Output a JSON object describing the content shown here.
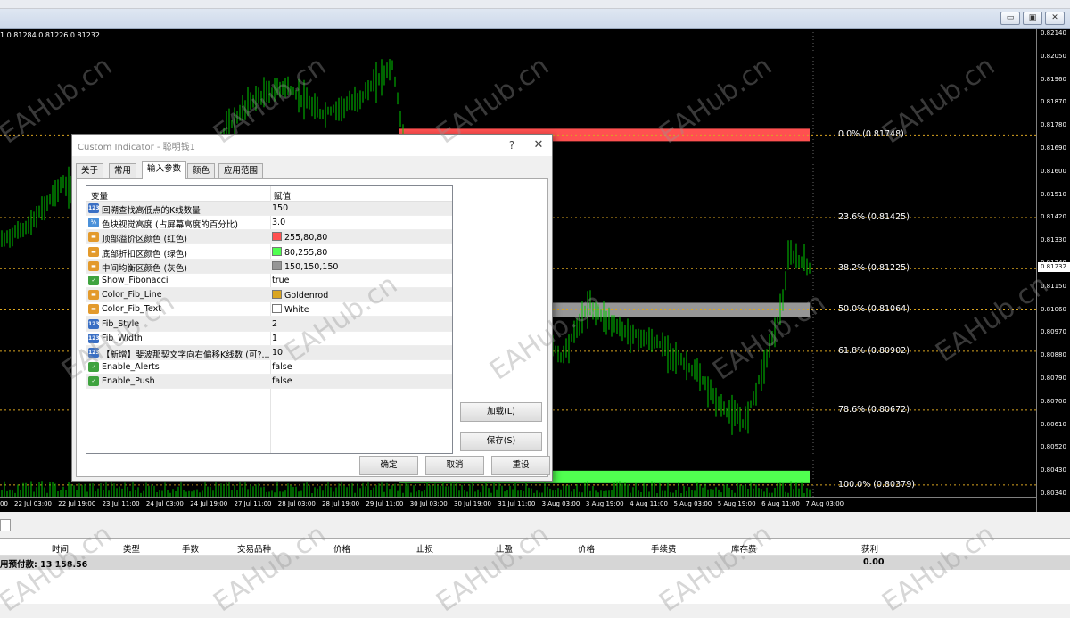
{
  "window": {
    "min_btn": "▭",
    "restore_btn": "▣",
    "close_btn": "✕"
  },
  "chart": {
    "ohlc_header": "1 0.81284 0.81226 0.81232",
    "current_price": "0.81232",
    "price_labels": [
      "0.82140",
      "0.82050",
      "0.81960",
      "0.81870",
      "0.81780",
      "0.81690",
      "0.81600",
      "0.81510",
      "0.81420",
      "0.81330",
      "0.81240",
      "0.81150",
      "0.81060",
      "0.80970",
      "0.80880",
      "0.80790",
      "0.80700",
      "0.80610",
      "0.80520",
      "0.80430",
      "0.80340"
    ],
    "time_labels": [
      "00",
      "22 Jul 03:00",
      "22 Jul 19:00",
      "23 Jul 11:00",
      "24 Jul 03:00",
      "24 Jul 19:00",
      "27 Jul 11:00",
      "28 Jul 03:00",
      "28 Jul 19:00",
      "29 Jul 11:00",
      "30 Jul 03:00",
      "30 Jul 19:00",
      "31 Jul 11:00",
      "3 Aug 03:00",
      "3 Aug 19:00",
      "4 Aug 11:00",
      "5 Aug 03:00",
      "5 Aug 19:00",
      "6 Aug 11:00",
      "7 Aug 03:00"
    ],
    "fib_levels": [
      {
        "label": "0.0% (0.81748)",
        "price": 0.81748
      },
      {
        "label": "23.6% (0.81425)",
        "price": 0.81425
      },
      {
        "label": "38.2% (0.81225)",
        "price": 0.81225
      },
      {
        "label": "50.0% (0.81064)",
        "price": 0.81064
      },
      {
        "label": "61.8% (0.80902)",
        "price": 0.80902
      },
      {
        "label": "78.6% (0.80672)",
        "price": 0.80672
      },
      {
        "label": "100.0% (0.80379)",
        "price": 0.80379
      }
    ],
    "zone_colors": {
      "premium": "#FF5050",
      "discount": "#50FF50",
      "equilibrium": "#969696"
    },
    "candle_color": "#00c800"
  },
  "terminal": {
    "columns": [
      "时间",
      "类型",
      "手数",
      "交易品种",
      "价格",
      "止损",
      "止盈",
      "价格",
      "手续费",
      "库存费",
      "获利"
    ],
    "balance_label": "用预付款: 13 158.56",
    "profit_total": "0.00"
  },
  "dialog": {
    "title": "Custom Indicator - 聪明钱1",
    "help": "?",
    "close": "✕",
    "tabs": [
      "关于",
      "常用",
      "输入参数",
      "颜色",
      "应用范围"
    ],
    "active_tab": "输入参数",
    "col_variable": "变量",
    "col_value": "赋值",
    "params": [
      {
        "icon": "123",
        "name": "回溯查找高低点的K线数量",
        "value": "150"
      },
      {
        "icon": "1/2",
        "name": "色块视觉高度 (占屏幕高度的百分比)",
        "value": "3.0"
      },
      {
        "icon": "col",
        "name": "顶部溢价区颜色 (红色)",
        "value": "255,80,80",
        "color": "#FF5050"
      },
      {
        "icon": "col",
        "name": "底部折扣区颜色 (绿色)",
        "value": "80,255,80",
        "color": "#50FF50"
      },
      {
        "icon": "col",
        "name": "中间均衡区颜色 (灰色)",
        "value": "150,150,150",
        "color": "#969696"
      },
      {
        "icon": "bool",
        "name": "Show_Fibonacci",
        "value": "true"
      },
      {
        "icon": "col",
        "name": "Color_Fib_Line",
        "value": "Goldenrod",
        "color": "#DAA520"
      },
      {
        "icon": "col",
        "name": "Color_Fib_Text",
        "value": "White",
        "color": "#FFFFFF"
      },
      {
        "icon": "123",
        "name": "Fib_Style",
        "value": "2"
      },
      {
        "icon": "123",
        "name": "Fib_Width",
        "value": "1"
      },
      {
        "icon": "123",
        "name": "【新增】斐波那契文字向右偏移K线数 (可?...",
        "value": "10"
      },
      {
        "icon": "bool",
        "name": "Enable_Alerts",
        "value": "false"
      },
      {
        "icon": "bool",
        "name": "Enable_Push",
        "value": "false"
      }
    ],
    "btn_load": "加载(L)",
    "btn_save": "保存(S)",
    "btn_ok": "确定",
    "btn_cancel": "取消",
    "btn_reset": "重设"
  },
  "watermark": "EAHub.cn"
}
